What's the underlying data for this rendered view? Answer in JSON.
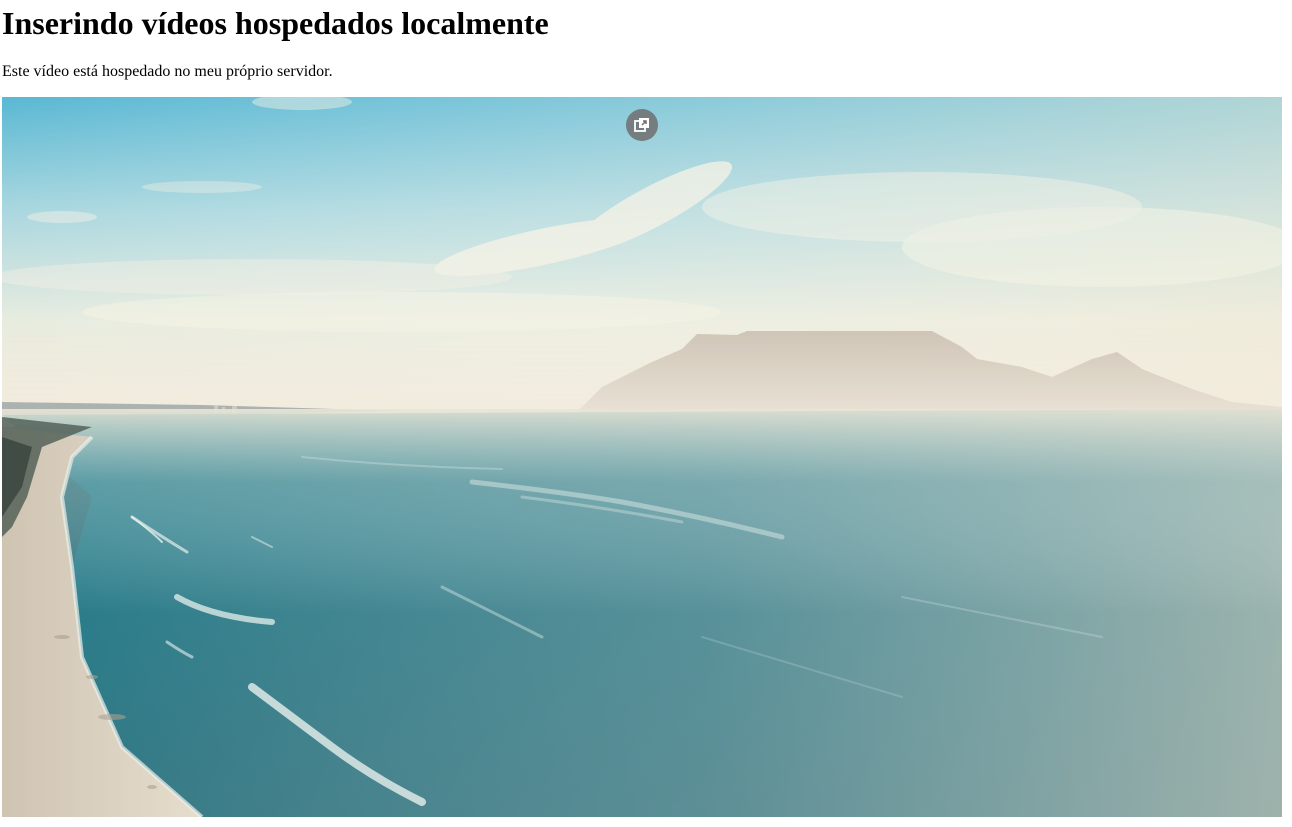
{
  "page": {
    "heading": "Inserindo vídeos hospedados localmente",
    "description": "Este vídeo está hospedado no meu próprio servidor."
  },
  "video": {
    "pip_icon": "picture-in-picture-icon"
  }
}
